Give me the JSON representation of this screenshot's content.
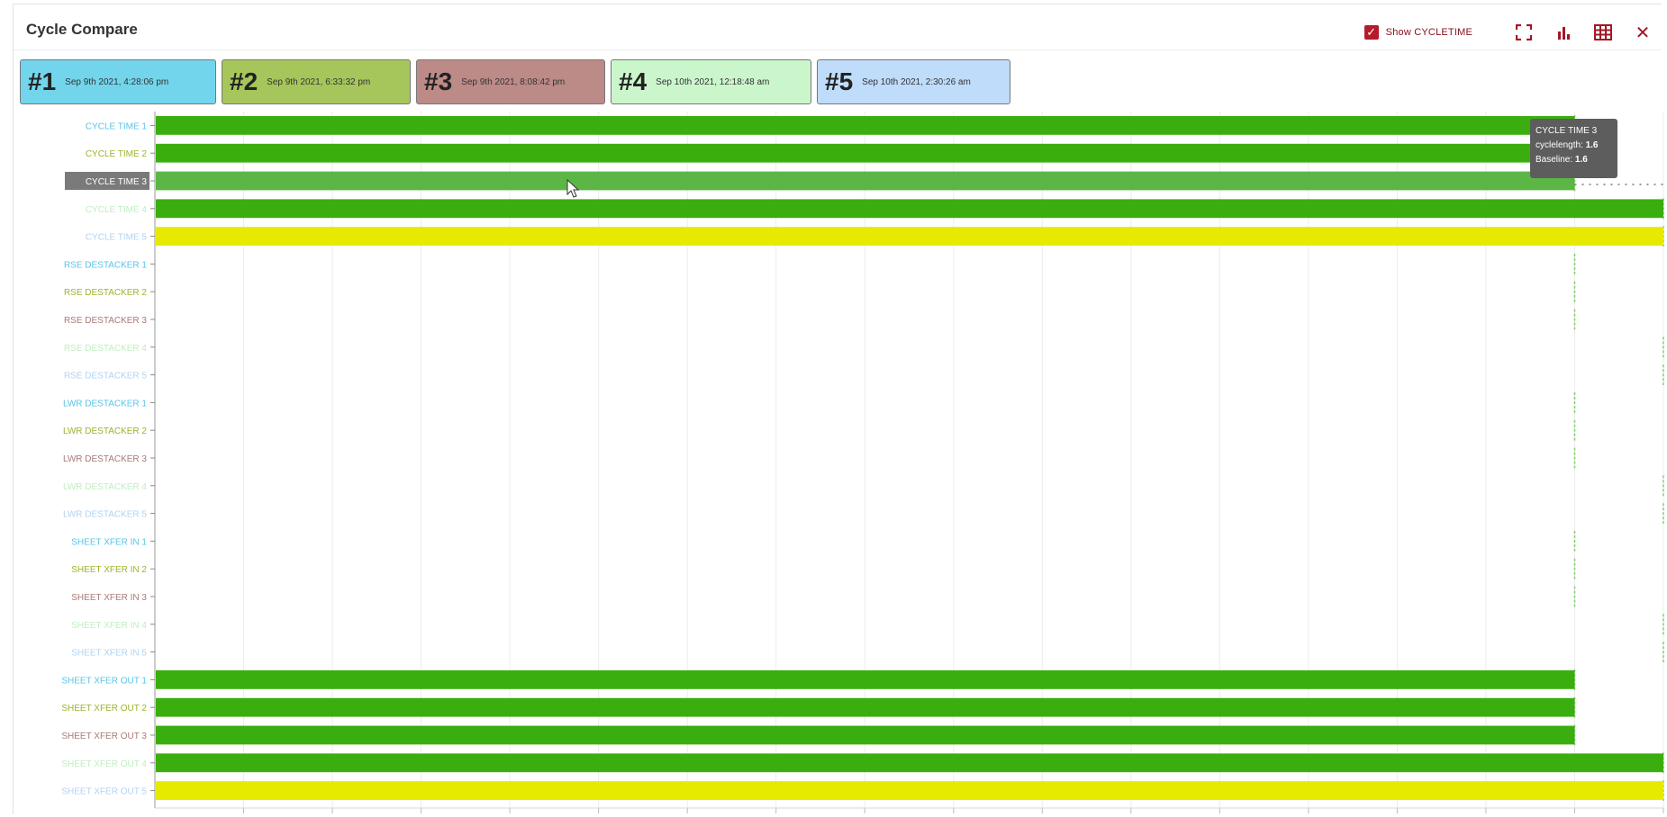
{
  "panel": {
    "title": "Cycle Compare"
  },
  "toolbar": {
    "show_label": "Show CYCLETIME",
    "checkbox_glyph": "✓",
    "close_glyph": "✕",
    "icons": [
      "fullscreen-icon",
      "bar-chart-icon",
      "table-icon",
      "close-icon"
    ]
  },
  "cycles": [
    {
      "num": "#1",
      "date": "Sep 9th 2021, 4:28:06 pm",
      "color": "#72d5ec"
    },
    {
      "num": "#2",
      "date": "Sep 9th 2021, 6:33:32 pm",
      "color": "#a6c65b"
    },
    {
      "num": "#3",
      "date": "Sep 9th 2021, 8:08:42 pm",
      "color": "#bc8a87"
    },
    {
      "num": "#4",
      "date": "Sep 10th 2021, 12:18:48 am",
      "color": "#cbf6cc"
    },
    {
      "num": "#5",
      "date": "Sep 10th 2021, 2:30:26 am",
      "color": "#bfdcfa"
    }
  ],
  "tooltip": {
    "title": "CYCLE TIME 3",
    "line1_label": "cyclelength:",
    "line1_value": "1.6",
    "line2_label": "Baseline:",
    "line2_value": "1.6"
  },
  "chart_data": {
    "type": "bar",
    "orientation": "horizontal",
    "xlim": [
      0,
      1.7
    ],
    "grid": true,
    "cycle_colors": [
      "#56c4e8",
      "#9ab52e",
      "#a87a78",
      "#bfeec0",
      "#b1d2f0"
    ],
    "categories": [
      "CYCLE TIME 1",
      "CYCLE TIME 2",
      "CYCLE TIME 3",
      "CYCLE TIME 4",
      "CYCLE TIME 5",
      "RSE DESTACKER 1",
      "RSE DESTACKER 2",
      "RSE DESTACKER 3",
      "RSE DESTACKER 4",
      "RSE DESTACKER 5",
      "LWR DESTACKER 1",
      "LWR DESTACKER 2",
      "LWR DESTACKER 3",
      "LWR DESTACKER 4",
      "LWR DESTACKER 5",
      "SHEET XFER IN 1",
      "SHEET XFER IN 2",
      "SHEET XFER IN 3",
      "SHEET XFER IN 4",
      "SHEET XFER IN 5",
      "SHEET XFER OUT 1",
      "SHEET XFER OUT 2",
      "SHEET XFER OUT 3",
      "SHEET XFER OUT 4",
      "SHEET XFER OUT 5"
    ],
    "values": [
      1.6,
      1.6,
      1.6,
      1.7,
      1.7,
      0,
      0,
      0,
      0,
      0,
      0,
      0,
      0,
      0,
      0,
      0,
      0,
      0,
      0,
      0,
      1.6,
      1.6,
      1.6,
      1.7,
      1.7
    ],
    "baseline": [
      1.6,
      1.6,
      1.6,
      1.7,
      1.7,
      1.6,
      1.6,
      1.6,
      1.7,
      1.7,
      1.6,
      1.6,
      1.6,
      1.7,
      1.7,
      1.6,
      1.6,
      1.6,
      1.7,
      1.7,
      1.6,
      1.6,
      1.6,
      1.7,
      1.7
    ],
    "bar_colors": [
      "#3aae0e",
      "#3aae0e",
      "#3aae0e",
      "#3aae0e",
      "#e6ea00",
      "#3aae0e",
      "#3aae0e",
      "#3aae0e",
      "#3aae0e",
      "#e6ea00",
      "#3aae0e",
      "#3aae0e",
      "#3aae0e",
      "#3aae0e",
      "#e6ea00",
      "#3aae0e",
      "#3aae0e",
      "#3aae0e",
      "#3aae0e",
      "#e6ea00",
      "#3aae0e",
      "#3aae0e",
      "#3aae0e",
      "#3aae0e",
      "#e6ea00"
    ],
    "highlighted": "CYCLE TIME 3"
  }
}
